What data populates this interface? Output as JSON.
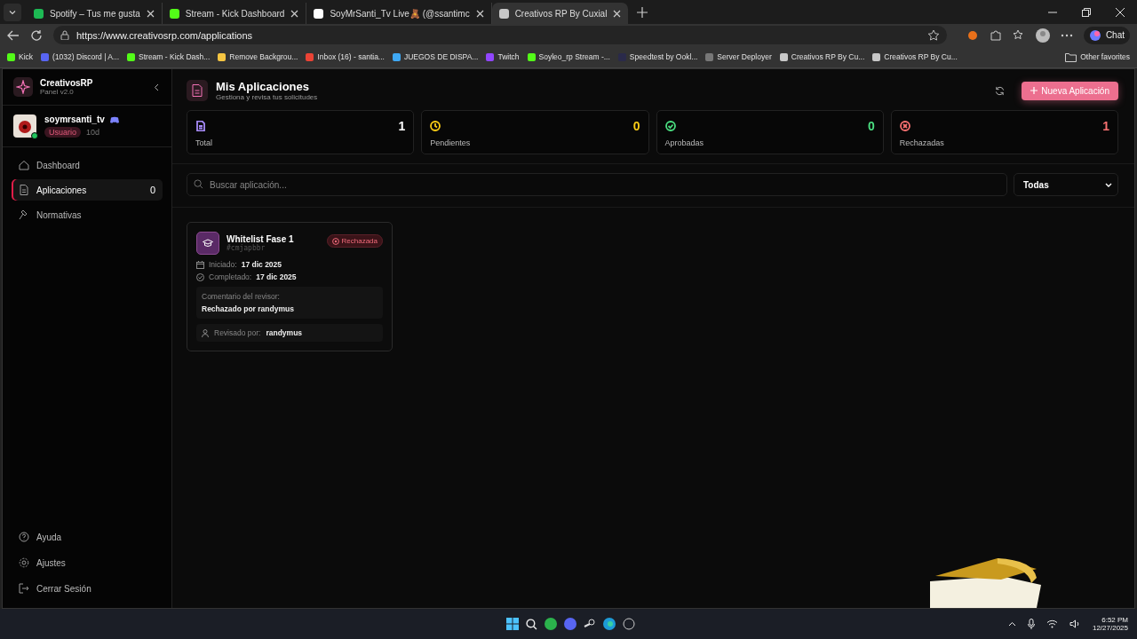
{
  "browser": {
    "tabs": [
      {
        "title": "Spotify – Tus me gusta",
        "selected": false,
        "color": "#1db954"
      },
      {
        "title": "Stream - Kick Dashboard",
        "selected": false,
        "color": "#53fc18"
      },
      {
        "title": "SoyMrSanti_Tv Live🧸 (@ssantimc",
        "selected": false,
        "color": "#ffffff"
      },
      {
        "title": "Creativos RP By Cuxial",
        "selected": true,
        "color": "#c8c8c8"
      }
    ],
    "url": "https://www.creativosrp.com/applications",
    "chat": "Chat",
    "bookmarks": [
      {
        "label": "Kick",
        "color": "#53fc18"
      },
      {
        "label": "(1032) Discord | A...",
        "color": "#5865f2"
      },
      {
        "label": "Stream - Kick Dash...",
        "color": "#53fc18"
      },
      {
        "label": "Remove Backgrou...",
        "color": "#f5c542"
      },
      {
        "label": "Inbox (16) - santia...",
        "color": "#ea4335"
      },
      {
        "label": "JUEGOS DE DISPA...",
        "color": "#3fa9f5"
      },
      {
        "label": "Twitch",
        "color": "#9146ff"
      },
      {
        "label": "Soyleo_rp Stream -...",
        "color": "#53fc18"
      },
      {
        "label": "Speedtest by Ookl...",
        "color": "#2a2a4a"
      },
      {
        "label": "Server Deployer",
        "color": "#777777"
      },
      {
        "label": "Creativos RP By Cu...",
        "color": "#c8c8c8"
      },
      {
        "label": "Creativos RP By Cu...",
        "color": "#c8c8c8"
      }
    ],
    "other_favorites": "Other favorites"
  },
  "sidebar": {
    "brand": "CreativosRP",
    "version": "Panel v2.0",
    "user": {
      "name": "soymrsanti_tv",
      "role": "Usuario",
      "age": "10d",
      "online": true
    },
    "nav": [
      {
        "label": "Dashboard",
        "selected": false,
        "kind": "home"
      },
      {
        "label": "Aplicaciones",
        "selected": true,
        "kind": "doc",
        "count": "0"
      },
      {
        "label": "Normativas",
        "selected": false,
        "kind": "gavel"
      }
    ],
    "footer": [
      {
        "label": "Ayuda",
        "kind": "help"
      },
      {
        "label": "Ajustes",
        "kind": "gear"
      },
      {
        "label": "Cerrar Sesión",
        "kind": "logout"
      }
    ]
  },
  "header": {
    "title": "Mis Aplicaciones",
    "subtitle": "Gestiona y revisa tus solicitudes",
    "button": "Nueva Aplicación"
  },
  "stats": [
    {
      "label": "Total",
      "value": "1",
      "color": "#a78bfa",
      "kind": "doc"
    },
    {
      "label": "Pendientes",
      "value": "0",
      "color": "#facc15",
      "kind": "clock"
    },
    {
      "label": "Aprobadas",
      "value": "0",
      "color": "#4ade80",
      "kind": "check"
    },
    {
      "label": "Rechazadas",
      "value": "1",
      "color": "#f87171",
      "kind": "x"
    }
  ],
  "search": {
    "placeholder": "Buscar aplicación..."
  },
  "filter": {
    "value": "Todas"
  },
  "cards": [
    {
      "title": "Whitelist Fase 1",
      "id": "#cmjapbbr",
      "status": "Rechazada",
      "started_label": "Iniciado:",
      "started": "17 dic 2025",
      "completed_label": "Completado:",
      "completed": "17 dic 2025",
      "comment_label": "Comentario del revisor:",
      "comment": "Rechazado por randymus",
      "reviewed_label": "Revisado por:",
      "reviewer": "randymus"
    }
  ],
  "taskbar": {
    "time": "6:52 PM",
    "date": "12/27/2025"
  }
}
